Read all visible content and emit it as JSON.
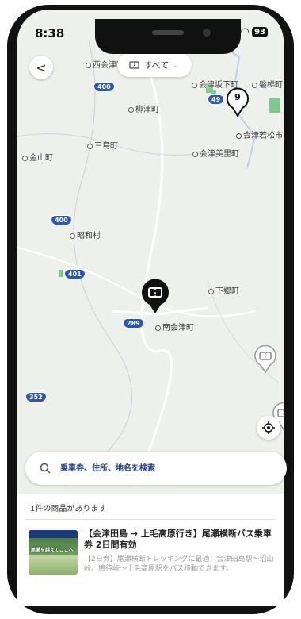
{
  "status_bar": {
    "time": "8:38",
    "battery": "93"
  },
  "map": {
    "places": [
      {
        "name": "西会津町"
      },
      {
        "name": "会津坂下町"
      },
      {
        "name": "磐梯町"
      },
      {
        "name": "柳津町"
      },
      {
        "name": "会津若松市"
      },
      {
        "name": "三島町"
      },
      {
        "name": "会津美里町"
      },
      {
        "name": "金山町"
      },
      {
        "name": "昭和村"
      },
      {
        "name": "下郷町"
      },
      {
        "name": "南会津町"
      }
    ],
    "routes": [
      "400",
      "49",
      "400",
      "401",
      "289",
      "352"
    ],
    "cluster_count": "9"
  },
  "controls": {
    "filter_label": "すべて",
    "back_label": "<",
    "icons": {
      "back": "chevron-left-icon",
      "filter": "ticket-icon",
      "locate": "locate-icon",
      "search": "search-icon"
    }
  },
  "search": {
    "placeholder": "乗車券、住所、地名を検索"
  },
  "results": {
    "count_text": "1件の商品があります",
    "items": [
      {
        "title": "【会津田島 → 上毛高原行き】尾瀬横断バス乗車券 2日間有効",
        "description": "【2日券】尾瀬横断トレッキングに最適！会津田島駅〜沼山峠、鳩待峠〜上毛高原駅をバス移動できます。",
        "thumbnail_text": "尾瀬を越えてここへ"
      }
    ]
  },
  "colors": {
    "route": "#2e55b8",
    "search_text": "#1f3a8a",
    "marker": "#111111"
  }
}
